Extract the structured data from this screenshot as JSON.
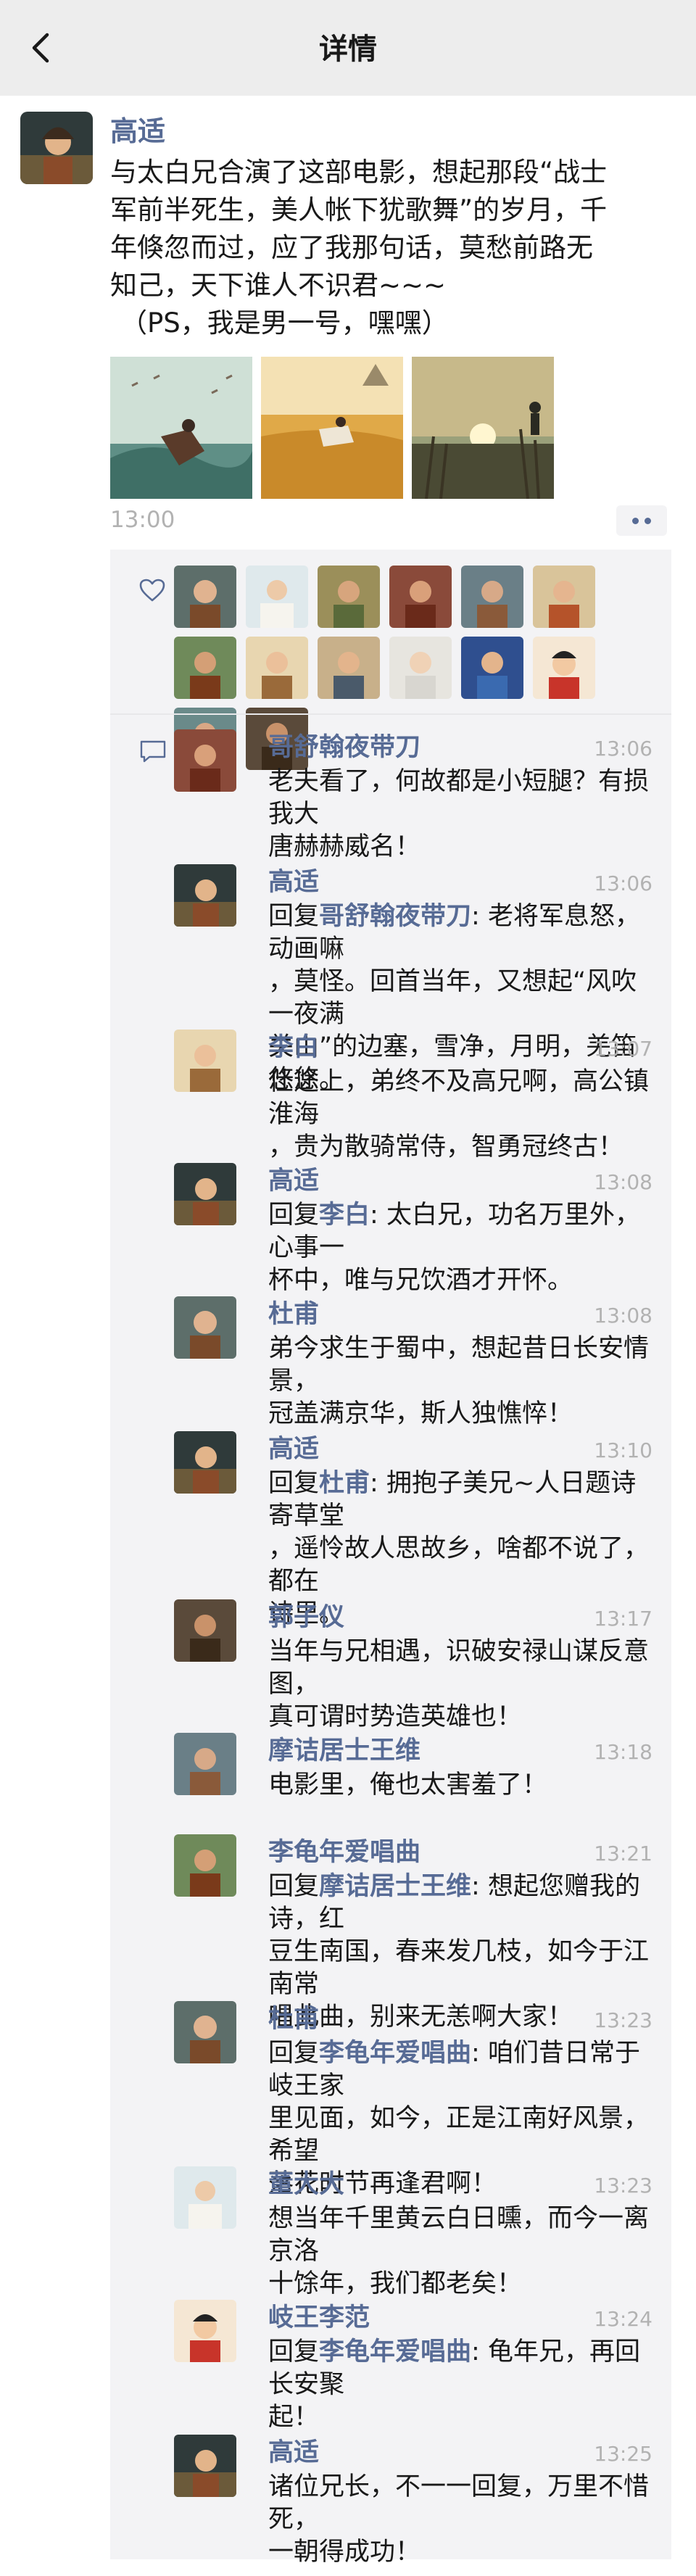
{
  "nav": {
    "title": "详情",
    "back_icon": "back-chevron-icon"
  },
  "post": {
    "author": "高适",
    "text_lines": [
      "与太白兄合演了这部电影，想起那段“战士",
      "军前半死生，美人帐下犹歌舞”的岁月，千",
      "年倏忽而过，应了我那句话，莫愁前路无",
      "知己，天下谁人不识君~~~",
      "（PS，我是男一号，嘿嘿）"
    ],
    "time": "13:00",
    "photos": [
      "horse-rider-painting",
      "grassland-rider-painting",
      "sunset-reeds-painting"
    ]
  },
  "likes": {
    "icon": "heart-icon",
    "count": 14
  },
  "comments_icon": "comment-icon",
  "comments": [
    {
      "name": "哥舒翰夜带刀",
      "time": "13:06",
      "lines": [
        "老夫看了，何故都是小短腿？有损我大",
        "唐赫赫威名！"
      ],
      "reply_to": ""
    },
    {
      "name": "高适",
      "time": "13:06",
      "reply_prefix": "回复",
      "reply_to": "哥舒翰夜带刀",
      "lines": [
        ": 老将军息怒，动画嘛",
        "，莫怪。回首当年，又想起“风吹一夜满",
        "关山”的边塞，雪净，月明，羌笛悠悠。"
      ]
    },
    {
      "name": "李白",
      "time": "13:07",
      "lines": [
        "仕途上，弟终不及高兄啊，高公镇淮海",
        "，贵为散骑常侍，智勇冠终古！"
      ],
      "reply_to": ""
    },
    {
      "name": "高适",
      "time": "13:08",
      "reply_prefix": "回复",
      "reply_to": "李白",
      "lines": [
        ": 太白兄，功名万里外，心事一",
        "杯中，唯与兄饮酒才开怀。"
      ]
    },
    {
      "name": "杜甫",
      "time": "13:08",
      "lines": [
        "弟今求生于蜀中，想起昔日长安情景，",
        "冠盖满京华，斯人独憔悴！"
      ],
      "reply_to": ""
    },
    {
      "name": "高适",
      "time": "13:10",
      "reply_prefix": "回复",
      "reply_to": "杜甫",
      "lines": [
        ": 拥抱子美兄~人日题诗寄草堂",
        "，遥怜故人思故乡，啥都不说了，都在",
        "诗里。"
      ]
    },
    {
      "name": "郭子仪",
      "time": "13:17",
      "lines": [
        "当年与兄相遇，识破安禄山谋反意图，",
        "真可谓时势造英雄也！"
      ],
      "reply_to": ""
    },
    {
      "name": "摩诘居士王维",
      "time": "13:18",
      "lines": [
        "电影里，俺也太害羞了！"
      ],
      "reply_to": ""
    },
    {
      "name": "李龟年爱唱曲",
      "time": "13:21",
      "reply_prefix": "回复",
      "reply_to": "摩诘居士王维",
      "lines": [
        ": 想起您赠我的诗，红",
        "豆生南国，春来发几枝，如今于江南常",
        "唱此曲，别来无恙啊大家！"
      ]
    },
    {
      "name": "杜甫",
      "time": "13:23",
      "reply_prefix": "回复",
      "reply_to": "李龟年爱唱曲",
      "lines": [
        ": 咱们昔日常于岐王家",
        "里见面，如今，正是江南好风景，希望",
        "落花时节再逢君啊！"
      ]
    },
    {
      "name": "董大大",
      "time": "13:23",
      "lines": [
        "想当年千里黄云白日曛，而今一离京洛",
        "十馀年，我们都老矣！"
      ],
      "reply_to": ""
    },
    {
      "name": "岐王李范",
      "time": "13:24",
      "reply_prefix": "回复",
      "reply_to": "李龟年爱唱曲",
      "lines": [
        ": 龟年兄，再回长安聚",
        "起！"
      ]
    },
    {
      "name": "高适",
      "time": "13:25",
      "lines": [
        "诸位兄长，不一一回复，万里不惜死，",
        "一朝得成功！"
      ],
      "reply_to": ""
    }
  ]
}
